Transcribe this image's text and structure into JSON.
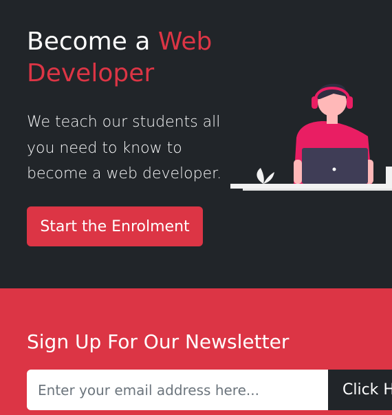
{
  "hero": {
    "title_prefix": "Become a ",
    "title_highlight": "Web Developer",
    "description": "We teach our students all you need to know to become a web developer.",
    "cta_label": "Start the Enrolment"
  },
  "newsletter": {
    "title": "Sign Up For Our Newsletter",
    "email_placeholder": "Enter your email address here...",
    "submit_label": "Click Here"
  },
  "colors": {
    "dark": "#212529",
    "accent": "#dc3545",
    "light": "#f8f9fa",
    "headphones": "#e91e63",
    "laptop": "#3f3d56",
    "skin": "#ffb8b8"
  }
}
